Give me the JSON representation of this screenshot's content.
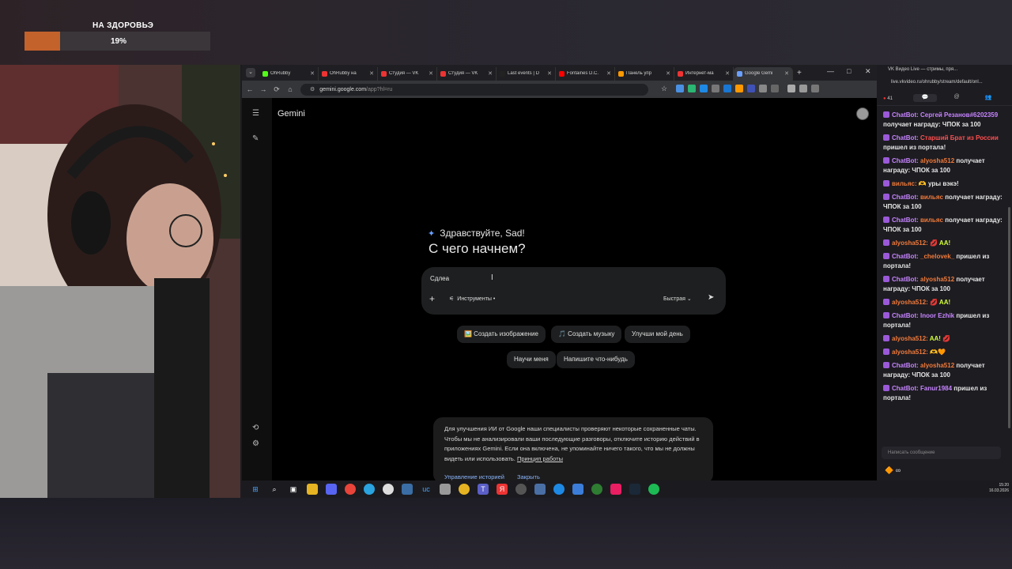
{
  "overlay": {
    "donation_title": "НА ЗДОРОВЬЭ",
    "donation_percent": "19%",
    "donation_progress": 0.19
  },
  "browser": {
    "tabs": [
      {
        "label": "OhRubby",
        "color": "#53fc18",
        "active": false
      },
      {
        "label": "OhRubby на",
        "color": "#e33",
        "active": false
      },
      {
        "label": "Студия — VK",
        "color": "#e33",
        "active": false
      },
      {
        "label": "Студия — VK",
        "color": "#e33",
        "active": false
      },
      {
        "label": "Last events | D",
        "color": "#222",
        "active": false
      },
      {
        "label": "Fontaines D.C.",
        "color": "#f00",
        "active": false
      },
      {
        "label": "Панель упр",
        "color": "#f90",
        "active": false
      },
      {
        "label": "Интернет-ма",
        "color": "#e33",
        "active": false
      },
      {
        "label": "Google Gemi",
        "color": "#6aa0ff",
        "active": true
      }
    ],
    "tab_list": "⌄",
    "new_tab": "+",
    "window_controls": [
      "—",
      "□",
      "✕"
    ],
    "url_host": "gemini.google.com",
    "url_path": "/app?hl=ru",
    "nav": [
      "←",
      "→",
      "⟳",
      "⌂",
      "⚙"
    ],
    "star": "☆"
  },
  "gemini": {
    "title": "Gemini",
    "greeting": "Здравствуйте, Sad!",
    "headline": "С чего начнем?",
    "prompt_text": "Сдлеа",
    "tools_label": "Инструменты",
    "model_label": "Быстрая",
    "chips": [
      "🖼️ Создать изображение",
      "🎵 Создать музыку",
      "Улучши мой день",
      "Научи меня",
      "Напишите что-нибудь"
    ],
    "notice_text": "Для улучшения ИИ от Google наши специалисты проверяют некоторые сохраненные чаты. Чтобы мы не анализировали ваши последующие разговоры, отключите историю действий в приложениях Gemini. Если она включена, не упоминайте ничего такого, что мы не должны видеть или использовать.",
    "notice_link": "Принцип работы",
    "manage_history": "Управление историей",
    "close": "Закрыть"
  },
  "taskbar": {
    "time": "15:20",
    "date": "16.03.2026"
  },
  "chat": {
    "title": "VK Видео Live — стримы, пря...",
    "url": "live.vkvideo.ru/ohrubby/stream/default/onl...",
    "viewers": "41",
    "input_placeholder": "Написать сообщение",
    "messages": [
      {
        "user": "ChatBot:",
        "user_color": "#c684ff",
        "parts": [
          {
            "t": "Сергей Резанов#6202359",
            "c": "#c684ff"
          },
          {
            "t": " получает награду: ЧПОК за 100",
            "c": ""
          }
        ]
      },
      {
        "user": "ChatBot:",
        "user_color": "#c684ff",
        "parts": [
          {
            "t": "Старший Брат из России",
            "c": "#ff4f4f"
          },
          {
            "t": " пришел из портала!",
            "c": ""
          }
        ]
      },
      {
        "user": "ChatBot:",
        "user_color": "#c684ff",
        "parts": [
          {
            "t": "alyosha512",
            "c": "#f07a3a"
          },
          {
            "t": " получает награду: ЧПОК за 100",
            "c": ""
          }
        ]
      },
      {
        "user": "вильяс:",
        "user_color": "#f07a3a",
        "parts": [
          {
            "t": "🫶 уры вэкэ!",
            "c": ""
          }
        ]
      },
      {
        "user": "ChatBot:",
        "user_color": "#c684ff",
        "parts": [
          {
            "t": "вильяс",
            "c": "#f07a3a"
          },
          {
            "t": " получает награду: ЧПОК за 100",
            "c": ""
          }
        ]
      },
      {
        "user": "ChatBot:",
        "user_color": "#c684ff",
        "parts": [
          {
            "t": "вильяс",
            "c": "#f07a3a"
          },
          {
            "t": " получает награду: ЧПОК за 100",
            "c": ""
          }
        ]
      },
      {
        "user": "alyosha512:",
        "user_color": "#f07a3a",
        "parts": [
          {
            "t": " 💋 AA! ",
            "c": "#d4ff3a"
          }
        ]
      },
      {
        "user": "ChatBot:",
        "user_color": "#c684ff",
        "parts": [
          {
            "t": "_chelovek_",
            "c": "#f07a3a"
          },
          {
            "t": " пришел из портала!",
            "c": ""
          }
        ]
      },
      {
        "user": "ChatBot:",
        "user_color": "#c684ff",
        "parts": [
          {
            "t": "alyosha512",
            "c": "#f07a3a"
          },
          {
            "t": " получает награду: ЧПОК за 100",
            "c": ""
          }
        ]
      },
      {
        "user": "alyosha512:",
        "user_color": "#f07a3a",
        "parts": [
          {
            "t": " 💋 AA!",
            "c": "#d4ff3a"
          }
        ]
      },
      {
        "user": "ChatBot:",
        "user_color": "#c684ff",
        "parts": [
          {
            "t": "Inoor Ezhik",
            "c": "#c684ff"
          },
          {
            "t": " пришел из портала!",
            "c": ""
          }
        ]
      },
      {
        "user": "alyosha512:",
        "user_color": "#f07a3a",
        "parts": [
          {
            "t": " AA! 💋",
            "c": "#d4ff3a"
          }
        ]
      },
      {
        "user": "alyosha512:",
        "user_color": "#f07a3a",
        "parts": [
          {
            "t": " 🫶🧡",
            "c": ""
          }
        ]
      },
      {
        "user": "ChatBot:",
        "user_color": "#c684ff",
        "parts": [
          {
            "t": "alyosha512",
            "c": "#f07a3a"
          },
          {
            "t": " получает награду: ЧПОК за 100",
            "c": ""
          }
        ]
      },
      {
        "user": "ChatBot:",
        "user_color": "#c684ff",
        "parts": [
          {
            "t": "Fanur1984",
            "c": "#c684ff"
          },
          {
            "t": " пришел из портала!",
            "c": ""
          }
        ]
      }
    ]
  }
}
